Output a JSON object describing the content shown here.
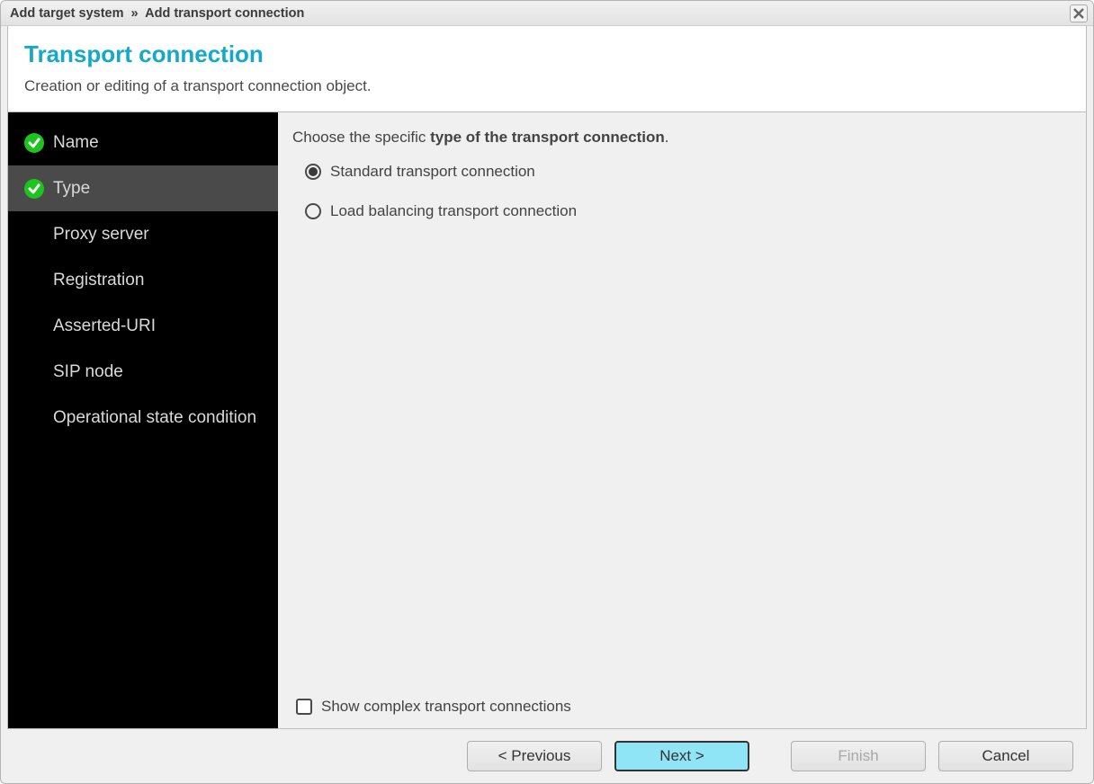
{
  "titlebar": {
    "part1": "Add target system",
    "sep": "»",
    "part2": "Add transport connection"
  },
  "header": {
    "title": "Transport connection",
    "description": "Creation or editing of a transport connection object."
  },
  "sidebar": {
    "steps": [
      {
        "label": "Name",
        "completed": true,
        "active": false
      },
      {
        "label": "Type",
        "completed": true,
        "active": true
      },
      {
        "label": "Proxy server",
        "completed": false,
        "active": false
      },
      {
        "label": "Registration",
        "completed": false,
        "active": false
      },
      {
        "label": "Asserted-URI",
        "completed": false,
        "active": false
      },
      {
        "label": "SIP node",
        "completed": false,
        "active": false
      },
      {
        "label": "Operational state condition",
        "completed": false,
        "active": false
      }
    ]
  },
  "content": {
    "prompt_prefix": "Choose the specific ",
    "prompt_bold": "type of the transport connection",
    "prompt_suffix": ".",
    "options": [
      {
        "label": "Standard transport connection",
        "selected": true
      },
      {
        "label": "Load balancing transport connection",
        "selected": false
      }
    ],
    "show_complex_label": "Show complex transport connections",
    "show_complex_checked": false
  },
  "footer": {
    "previous": "< Previous",
    "next": "Next >",
    "finish": "Finish",
    "cancel": "Cancel"
  }
}
